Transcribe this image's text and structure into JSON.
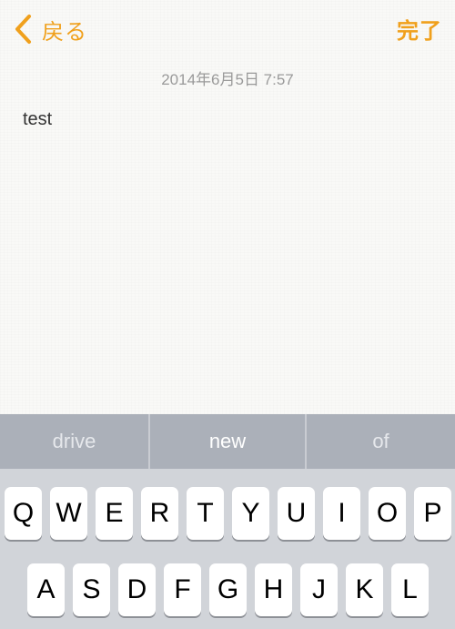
{
  "nav": {
    "back_label": "戻る",
    "done_label": "完了",
    "accent_color": "#f0a01c"
  },
  "note": {
    "timestamp": "2014年6月5日 7:57",
    "body": "test"
  },
  "predictive": {
    "suggestions": [
      "drive",
      "new",
      "of"
    ]
  },
  "keyboard": {
    "row1": [
      "Q",
      "W",
      "E",
      "R",
      "T",
      "Y",
      "U",
      "I",
      "O",
      "P"
    ],
    "row2": [
      "A",
      "S",
      "D",
      "F",
      "G",
      "H",
      "J",
      "K",
      "L"
    ]
  }
}
